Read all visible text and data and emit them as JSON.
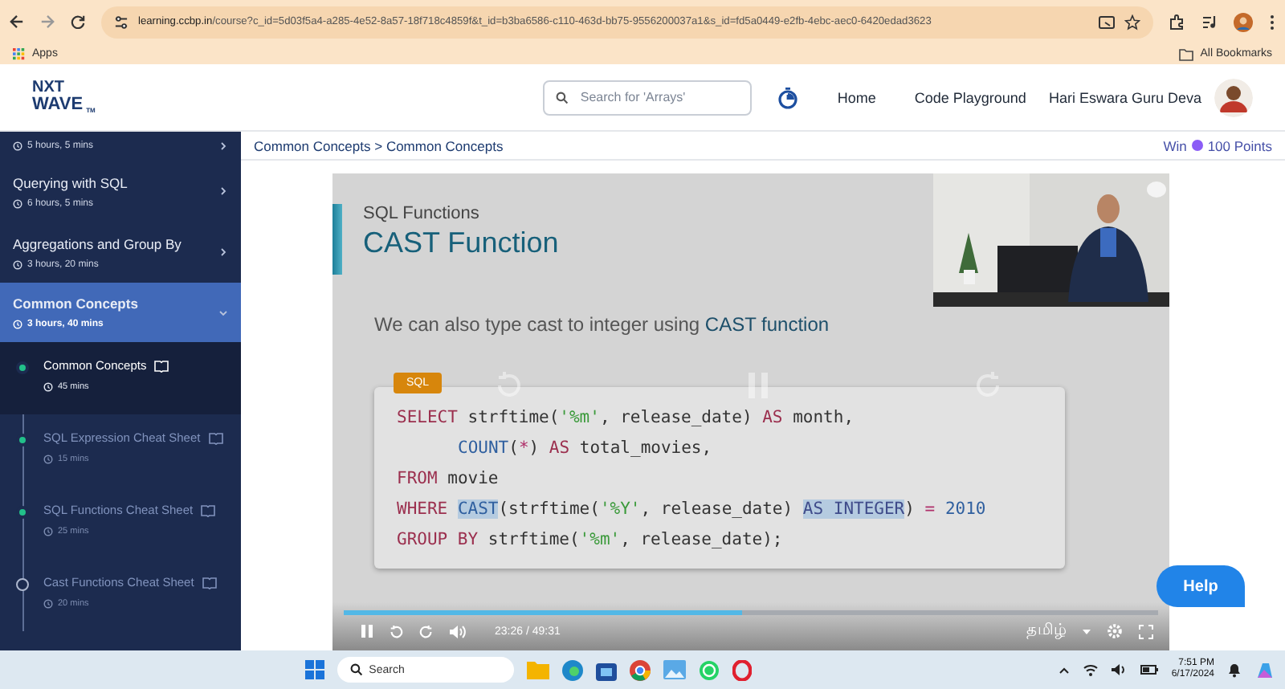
{
  "browser": {
    "url_host": "learning.ccbp.in",
    "url_path": "/course?c_id=5d03f5a4-a285-4e52-8a57-18f718c4859f&t_id=b3ba6586-c110-463d-bb75-9556200037a1&s_id=fd5a0449-e2fb-4ebc-aec0-6420edad3623",
    "bookmarks": [
      "Apps",
      "All Bookmarks"
    ]
  },
  "header": {
    "logo_top": "NXT",
    "logo_bottom": "WAVE",
    "logo_mark": "TM",
    "search": {
      "placeholder": "Search for 'Arrays'"
    },
    "nav": [
      "Home",
      "Code Playground"
    ],
    "user": "Hari Eswara Guru Deva"
  },
  "sidebar": {
    "modules": [
      {
        "duration": "5 hours, 5 mins",
        "selected": false,
        "expanded": false
      },
      {
        "title": "Querying with SQL",
        "duration": "6 hours, 5 mins",
        "selected": false,
        "expanded": false
      },
      {
        "title": "Aggregations and Group By",
        "duration": "3 hours, 20 mins",
        "selected": false,
        "expanded": false
      },
      {
        "title": "Common Concepts",
        "duration": "3 hours, 40 mins",
        "selected": true,
        "expanded": true,
        "children": [
          {
            "title": "Common Concepts",
            "duration": "45 mins",
            "selected": true,
            "completed": true
          },
          {
            "title": "SQL Expression Cheat Sheet",
            "duration": "15 mins",
            "selected": false,
            "completed": true
          },
          {
            "title": "SQL Functions Cheat Sheet",
            "duration": "25 mins",
            "selected": false,
            "completed": true
          },
          {
            "title": "Cast Functions Cheat Sheet",
            "duration": "20 mins",
            "selected": false,
            "completed": false
          }
        ]
      }
    ]
  },
  "breadcrumb": "Common Concepts > Common Concepts",
  "points": {
    "prefix": "Win",
    "value": "100 Points"
  },
  "video": {
    "slide": {
      "subtitle": "SQL Functions",
      "title": "CAST Function",
      "text": "We can also type cast to integer using **CAST function**",
      "code_label": "SQL",
      "code_lines": [
        {
          "indented": false,
          "tokens": [
            {
              "t": "SELECT",
              "kind": "keyword"
            },
            {
              "t": " strftime(",
              "kind": "text"
            },
            {
              "t": "'%m'",
              "kind": "string"
            },
            {
              "t": ", release_date) ",
              "kind": "text"
            },
            {
              "t": "AS",
              "kind": "keyword"
            },
            {
              "t": " month,",
              "kind": "text"
            }
          ]
        },
        {
          "indented": true,
          "tokens": [
            {
              "t": "COUNT",
              "kind": "function"
            },
            {
              "t": "(",
              "kind": "text"
            },
            {
              "t": "*",
              "kind": "operator"
            },
            {
              "t": ") ",
              "kind": "text"
            },
            {
              "t": "AS",
              "kind": "keyword"
            },
            {
              "t": " total_movies,",
              "kind": "text"
            }
          ]
        },
        {
          "indented": false,
          "tokens": [
            {
              "t": "FROM",
              "kind": "keyword"
            },
            {
              "t": " movie",
              "kind": "text"
            }
          ]
        },
        {
          "indented": false,
          "tokens": [
            {
              "t": "WHERE ",
              "kind": "keyword"
            },
            {
              "t": "CAST",
              "kind": "function-marked"
            },
            {
              "t": "(strftime(",
              "kind": "text"
            },
            {
              "t": "'%Y'",
              "kind": "string"
            },
            {
              "t": ", release_date) ",
              "kind": "text"
            },
            {
              "t": "AS INTEGER",
              "kind": "keyword-marked"
            },
            {
              "t": ") ",
              "kind": "text"
            },
            {
              "t": "= ",
              "kind": "operator"
            },
            {
              "t": "2010",
              "kind": "number"
            }
          ]
        },
        {
          "indented": false,
          "tokens": [
            {
              "t": "GROUP BY",
              "kind": "keyword"
            },
            {
              "t": " strftime(",
              "kind": "text"
            },
            {
              "t": "'%m'",
              "kind": "string"
            },
            {
              "t": ", release_date);",
              "kind": "text"
            }
          ]
        }
      ]
    },
    "level": 0.49,
    "current_time": "23:26",
    "separator": "/",
    "duration": "49:31",
    "language": "தமிழ்"
  },
  "help": "Help",
  "taskbar": {
    "search": {
      "placeholder": "Search"
    },
    "time": "7:51 PM",
    "date": "6/17/2024"
  }
}
